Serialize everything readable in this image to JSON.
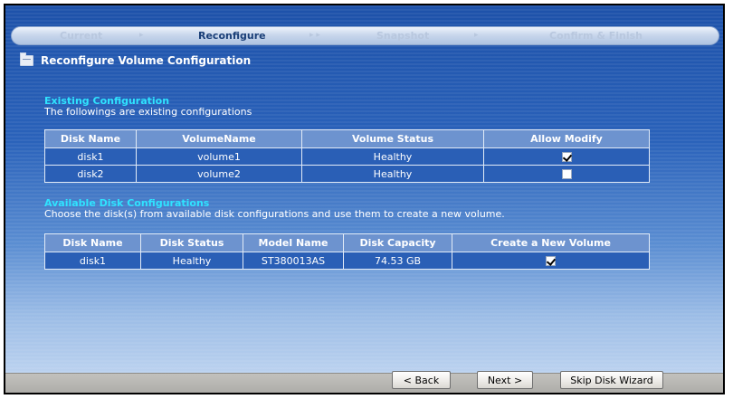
{
  "wizard": {
    "steps": [
      {
        "label": "Current"
      },
      {
        "label": "Reconfigure"
      },
      {
        "label": "Snapshot"
      },
      {
        "label": "Confirm & Finish"
      }
    ],
    "arrow_glyph": "▸",
    "arrow_double_glyph": "▸ ▸"
  },
  "page": {
    "title": "Reconfigure Volume Configuration"
  },
  "existing": {
    "title": "Existing Configuration",
    "subtitle": "The followings are existing configurations",
    "columns": [
      "Disk Name",
      "VolumeName",
      "Volume Status",
      "Allow Modify"
    ],
    "rows": [
      {
        "disk": "disk1",
        "volume": "volume1",
        "status": "Healthy",
        "allow_modify": true
      },
      {
        "disk": "disk2",
        "volume": "volume2",
        "status": "Healthy",
        "allow_modify": false
      }
    ]
  },
  "available": {
    "title": "Available Disk Configurations",
    "subtitle": "Choose the disk(s) from available disk configurations and use them to create a new volume.",
    "columns": [
      "Disk Name",
      "Disk Status",
      "Model Name",
      "Disk Capacity",
      "Create a New Volume"
    ],
    "rows": [
      {
        "disk": "disk1",
        "status": "Healthy",
        "model": "ST380013AS",
        "capacity": "74.53 GB",
        "create": true
      }
    ]
  },
  "buttons": {
    "back": "< Back",
    "next": "Next >",
    "skip": "Skip Disk Wizard"
  }
}
